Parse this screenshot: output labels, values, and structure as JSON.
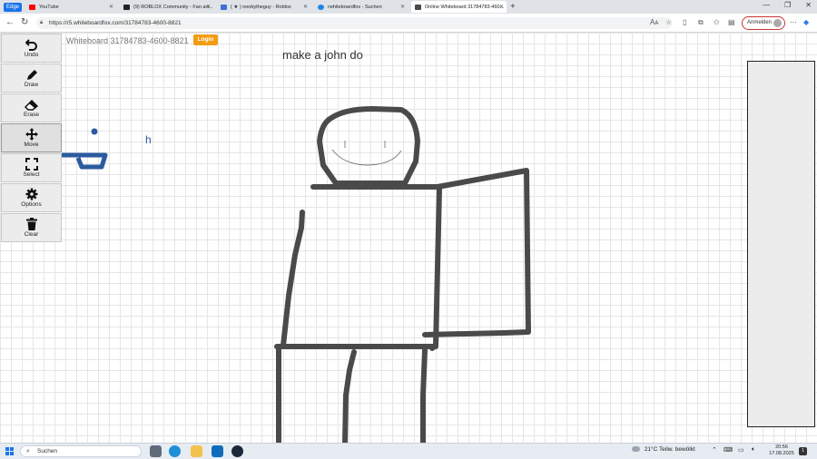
{
  "browser": {
    "edge_badge": "Edge",
    "tabs": [
      {
        "title": "YouTube",
        "favicon_color": "#ff0000"
      },
      {
        "title": "(9) ROBLOX Community - Fan art...",
        "favicon_color": "#222222"
      },
      {
        "title": "( ★ ) noobytheguy - Roblox",
        "favicon_color": "#3b6fd8"
      },
      {
        "title": "rwhiteboardfox - Suchen",
        "favicon_color": "#1e88e5"
      },
      {
        "title": "Online Whiteboard 31784783-460...",
        "favicon_color": "#4a4a4a"
      }
    ],
    "new_tab": "+",
    "window_controls": {
      "minimize": "—",
      "maximize": "❐",
      "close": "✕"
    },
    "url": "https://r5.whiteboardfox.com/31784783-4600-8821",
    "signin_label": "Anmelden"
  },
  "whiteboard": {
    "title": "Whiteboard 31784783-4600-8821",
    "login_label": "Login",
    "tools": [
      {
        "label": "Undo",
        "icon": "undo-icon"
      },
      {
        "label": "Draw",
        "icon": "pencil-icon"
      },
      {
        "label": "Erase",
        "icon": "eraser-icon"
      },
      {
        "label": "Move",
        "icon": "move-icon"
      },
      {
        "label": "Select",
        "icon": "select-icon"
      },
      {
        "label": "Options",
        "icon": "gear-icon"
      },
      {
        "label": "Clear",
        "icon": "trash-icon"
      }
    ],
    "active_tool": "Move",
    "notes": {
      "make_text": "make a john do",
      "h_text": "h"
    },
    "colors": {
      "stroke_dark": "#4a4a4a",
      "stroke_blue": "#2c5aa0",
      "face_stroke": "#777777"
    }
  },
  "taskbar": {
    "search_label": "Suchen",
    "weather_temp": "21°C",
    "weather_desc": "Teilw. bewölkt",
    "time": "20:56",
    "date": "17.08.2025",
    "notification_count": "1",
    "apps": [
      {
        "name": "task-view",
        "color": "#5f6b7a"
      },
      {
        "name": "edge",
        "color": "#1f8fd6"
      },
      {
        "name": "file-explorer",
        "color": "#f2c14e"
      },
      {
        "name": "outlook",
        "color": "#0f6cbd"
      },
      {
        "name": "steam",
        "color": "#1b2838"
      }
    ]
  }
}
